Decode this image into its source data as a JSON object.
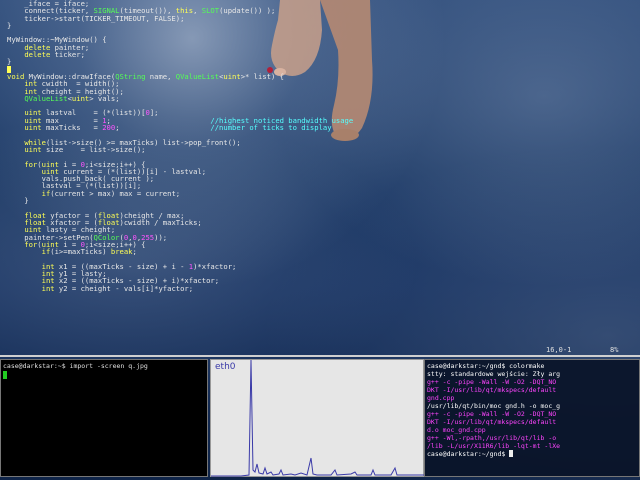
{
  "editor": {
    "lines": [
      "    _iface = iface;",
      "    connect(ticker, SIGNAL(timeout()), this, SLOT(update()) );",
      "    ticker->start(TICKER_TIMEOUT, FALSE);",
      "}",
      "",
      "MyWindow::~MyWindow() {",
      "    delete painter;",
      "    delete ticker;",
      "}",
      "",
      "void MyWindow::drawIface(QString name, QValueList<uint>* list) {",
      "    int cwidth  = width();",
      "    int cheight = height();",
      "    QValueList<uint> vals;",
      "",
      "    uint lastval    = (*(list))[0];",
      "    uint max        = 1;",
      "    uint maxTicks   = 200;",
      "",
      "    while(list->size() >= maxTicks) list->pop_front();",
      "    uint size    = list->size();",
      "",
      "    for(uint i = 0;i<size;i++) {",
      "        uint current = (*(list))[i] - lastval;",
      "        vals.push_back( current );",
      "        lastval = (*(list))[i];",
      "        if(current > max) max = current;",
      "    }",
      "",
      "    float yfactor = (float)cheight / max;",
      "    float xfactor = (float)cwidth / maxTicks;",
      "    uint lasty = cheight;",
      "    painter->setPen(QColor(0,0,255));",
      "    for(uint i = 0;i<size;i++) {",
      "        if(i>=maxTicks) break;",
      "",
      "        int x1 = ((maxTicks - size) + i - 1)*xfactor;",
      "        int y1 = lasty;",
      "        int x2 = ((maxTicks - size) + i)*xfactor;",
      "        int y2 = cheight - vals[i]*yfactor;"
    ],
    "comment_bandwidth": "//highest noticed bandwidth usage",
    "comment_ticks": "//number of ticks to display",
    "cursor_position": "16,0-1",
    "scroll_percent": "8%"
  },
  "term1": {
    "prompt": "case@darkstar:~$",
    "command": "import -screen q.jpg"
  },
  "graph": {
    "label": "eth0",
    "accent": "#3a3aa8"
  },
  "term2": {
    "lines": [
      {
        "text": "case@darkstar:~/gnd$ colormake",
        "style": "white"
      },
      {
        "text": "stty: standardowe wejście: Zły arg",
        "style": "white"
      },
      {
        "text": "g++ -c -pipe -Wall -W -O2  -DQT_NO",
        "style": "magenta"
      },
      {
        "text": "DKT -I/usr/lib/qt/mkspecs/default",
        "style": "magenta"
      },
      {
        "text": "gnd.cpp",
        "style": "magenta"
      },
      {
        "text": "/usr/lib/qt/bin/moc gnd.h -o moc_g",
        "style": "white"
      },
      {
        "text": "g++ -c -pipe -Wall -W -O2  -DQT_NO",
        "style": "magenta"
      },
      {
        "text": "DKT -I/usr/lib/qt/mkspecs/default",
        "style": "magenta"
      },
      {
        "text": "d.o moc_gnd.cpp",
        "style": "magenta"
      },
      {
        "text": "g++ -Wl,-rpath,/usr/lib/qt/lib -o",
        "style": "magenta"
      },
      {
        "text": "/lib -L/usr/X11R6/lib -lqt-mt -lXe",
        "style": "magenta"
      },
      {
        "text": "case@darkstar:~/gnd$",
        "style": "white"
      }
    ]
  }
}
